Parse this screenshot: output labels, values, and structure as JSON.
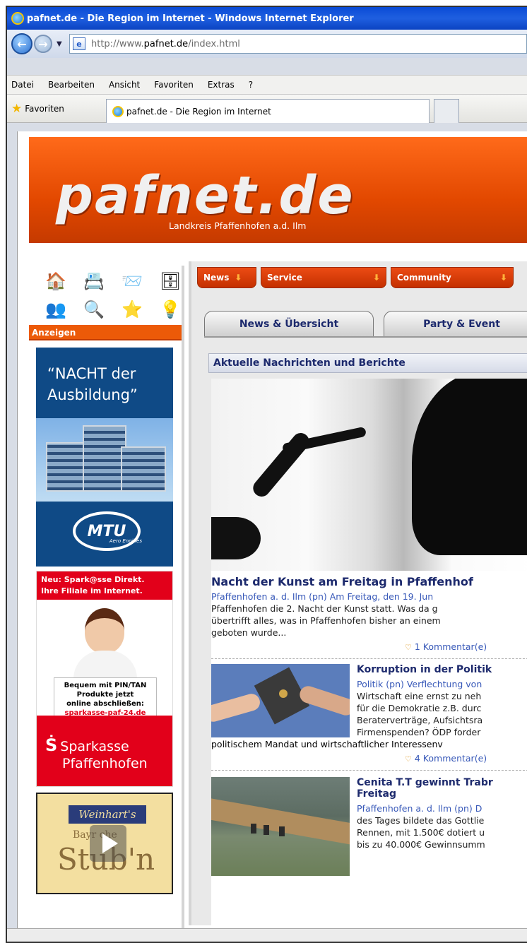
{
  "window": {
    "title": "pafnet.de - Die Region im Internet - Windows Internet Explorer"
  },
  "address": {
    "url_prefix": "http://www.",
    "url_host": "pafnet.de",
    "url_path": "/index.html"
  },
  "menu": {
    "items": [
      "Datei",
      "Bearbeiten",
      "Ansicht",
      "Favoriten",
      "Extras",
      "?"
    ]
  },
  "favbar": {
    "favorites_label": "Favoriten",
    "tab_title": "pafnet.de - Die Region im Internet"
  },
  "site": {
    "logo": "pafnet.de",
    "tagline": "Landkreis Pfaffenhofen a.d. Ilm",
    "ads_label": "Anzeigen",
    "nav": [
      {
        "label": "News"
      },
      {
        "label": "Service"
      },
      {
        "label": "Community"
      }
    ],
    "tabs": [
      "News & Übersicht",
      "Party & Event"
    ],
    "section_title": "Aktuelle Nachrichten und Berichte"
  },
  "ads": {
    "mtu_headline_1": "“NACHT der",
    "mtu_headline_2": "Ausbildung”",
    "mtu_logo": "MTU",
    "mtu_logo_sub": "Aero Engines",
    "spk_top_1": "Neu: Spark@sse Direkt.",
    "spk_top_2": "Ihre Filiale im Internet.",
    "spk_box_1": "Bequem mit PIN/TAN",
    "spk_box_2": "Produkte jetzt",
    "spk_box_3": "online abschließen:",
    "spk_box_4": "sparkasse-paf-24.de",
    "spk_name_1": "Sparkasse",
    "spk_name_2": "Pfaffenhofen",
    "weinhart_sign": "Weinhart's",
    "weinhart_sub": "Bayr   che",
    "weinhart_big": "Stub'n"
  },
  "articles": [
    {
      "title": "Nacht der Kunst am Freitag in Pfaffenhof",
      "lines": [
        "Pfaffenhofen a. d. Ilm (pn) Am Freitag, den 19. Jun",
        "Pfaffenhofen die 2. Nacht der Kunst statt. Was da g",
        "übertrifft alles, was in Pfaffenhofen bisher an einem",
        "geboten wurde..."
      ],
      "comments": "1 Kommentar(e)"
    },
    {
      "title": "Korruption in der Politik",
      "lines": [
        "Politik (pn) Verflechtung von",
        "Wirtschaft eine ernst zu neh",
        "für die Demokratie z.B. durc",
        "Beraterverträge, Aufsichtsra",
        "Firmenspenden? ÖDP forder"
      ],
      "wrap_line": "politischem Mandat und wirtschaftlicher Interessenv",
      "comments": "4 Kommentar(e)"
    },
    {
      "title_1": "Cenita T.T gewinnt Trabr",
      "title_2": "Freitag",
      "lines": [
        "Pfaffenhofen a. d. Ilm (pn) D",
        "des Tages bildete das Gottlie",
        "Rennen, mit 1.500€ dotiert u",
        "bis zu 40.000€ Gewinnsumm"
      ]
    }
  ]
}
